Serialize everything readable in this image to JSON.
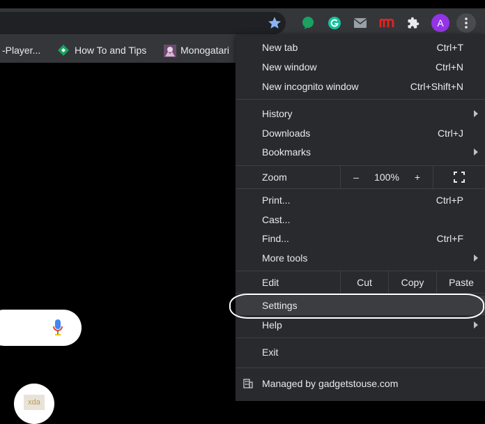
{
  "bookmarks": [
    {
      "label": "-Player..."
    },
    {
      "label": "How To and Tips"
    },
    {
      "label": "Monogatari"
    }
  ],
  "profile_initial": "A",
  "menu": {
    "new_tab": {
      "label": "New tab",
      "shortcut": "Ctrl+T"
    },
    "new_window": {
      "label": "New window",
      "shortcut": "Ctrl+N"
    },
    "new_incognito": {
      "label": "New incognito window",
      "shortcut": "Ctrl+Shift+N"
    },
    "history": {
      "label": "History"
    },
    "downloads": {
      "label": "Downloads",
      "shortcut": "Ctrl+J"
    },
    "bookmarks": {
      "label": "Bookmarks"
    },
    "zoom": {
      "label": "Zoom",
      "minus": "–",
      "value": "100%",
      "plus": "+"
    },
    "print": {
      "label": "Print...",
      "shortcut": "Ctrl+P"
    },
    "cast": {
      "label": "Cast..."
    },
    "find": {
      "label": "Find...",
      "shortcut": "Ctrl+F"
    },
    "more_tools": {
      "label": "More tools"
    },
    "edit": {
      "label": "Edit",
      "cut": "Cut",
      "copy": "Copy",
      "paste": "Paste"
    },
    "settings": {
      "label": "Settings"
    },
    "help": {
      "label": "Help"
    },
    "exit": {
      "label": "Exit"
    },
    "managed": {
      "label": "Managed by gadgetstouse.com"
    }
  },
  "xda_label": "xda",
  "colors": {
    "menu_bg": "#292a2d",
    "toolbar_bg": "#35363a",
    "accent_star": "#8ab4f8",
    "profile": "#9334e6"
  }
}
